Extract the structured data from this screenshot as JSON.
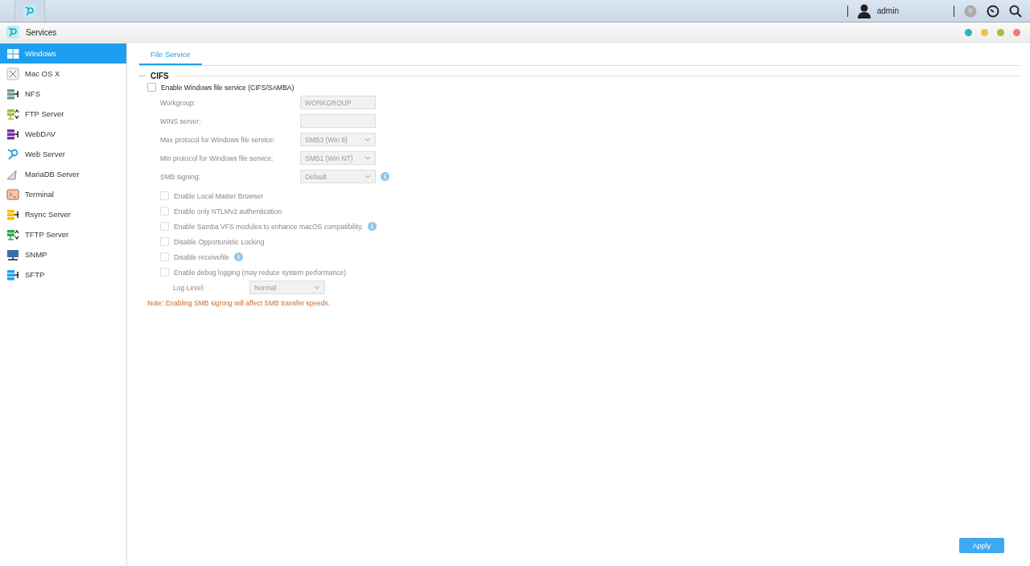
{
  "top_bar": {
    "user": "admin"
  },
  "window": {
    "title": "Services",
    "controls": [
      {
        "color": "#2ab3c0"
      },
      {
        "color": "#f5c342"
      },
      {
        "color": "#9cc33b"
      },
      {
        "color": "#f07a7a"
      }
    ]
  },
  "sidebar": {
    "items": [
      {
        "label": "Windows",
        "selected": true
      },
      {
        "label": "Mac OS X",
        "selected": false
      },
      {
        "label": "NFS",
        "selected": false
      },
      {
        "label": "FTP Server",
        "selected": false
      },
      {
        "label": "WebDAV",
        "selected": false
      },
      {
        "label": "Web Server",
        "selected": false
      },
      {
        "label": "MariaDB Server",
        "selected": false
      },
      {
        "label": "Terminal",
        "selected": false
      },
      {
        "label": "Rsync Server",
        "selected": false
      },
      {
        "label": "TFTP Server",
        "selected": false
      },
      {
        "label": "SNMP",
        "selected": false
      },
      {
        "label": "SFTP",
        "selected": false
      }
    ]
  },
  "tabs": [
    {
      "label": "File Service",
      "selected": true
    }
  ],
  "section": {
    "title": "CIFS",
    "enable": {
      "label": "Enable Windows file service (CIFS/SAMBA)",
      "checked": false
    },
    "fields": [
      {
        "kind": "text",
        "label": "Workgroup:",
        "value": "WORKGROUP",
        "disabled": true,
        "info": false
      },
      {
        "kind": "text",
        "label": "WINS server:",
        "disabled": true,
        "info": false
      },
      {
        "kind": "select",
        "label": "Max protocol for Windows file service:",
        "value": "SMB3 (Win 8)",
        "disabled": true,
        "info": false
      },
      {
        "kind": "select",
        "label": "Min protocol for Windows file service:",
        "value": "SMB1 (Win NT)",
        "disabled": true,
        "info": false
      },
      {
        "kind": "select",
        "label": "SMB signing:",
        "value": "Default",
        "disabled": true,
        "info": true
      }
    ],
    "options": [
      {
        "label": "Enable Local Master Browser",
        "checked": false,
        "disabled": true,
        "info": false
      },
      {
        "label": "Enable only NTLMv2 authentication",
        "checked": false,
        "disabled": true,
        "info": false
      },
      {
        "label": "Enable Samba VFS modules to enhance macOS compatibility.",
        "checked": false,
        "disabled": true,
        "info": true
      },
      {
        "label": "Disable Opportunistic Locking",
        "checked": false,
        "disabled": true,
        "info": false
      },
      {
        "label": "Disable receivefile",
        "checked": false,
        "disabled": true,
        "info": true
      },
      {
        "label": "Enable debug logging (may reduce system performance)",
        "checked": false,
        "disabled": true,
        "info": false
      }
    ],
    "log_level": {
      "label": "Log Level:",
      "value": "Normal",
      "disabled": true
    },
    "note": "Note: Enabling SMB signing will affect SMB transfer speeds."
  },
  "buttons": [
    {
      "label": "Apply"
    }
  ]
}
